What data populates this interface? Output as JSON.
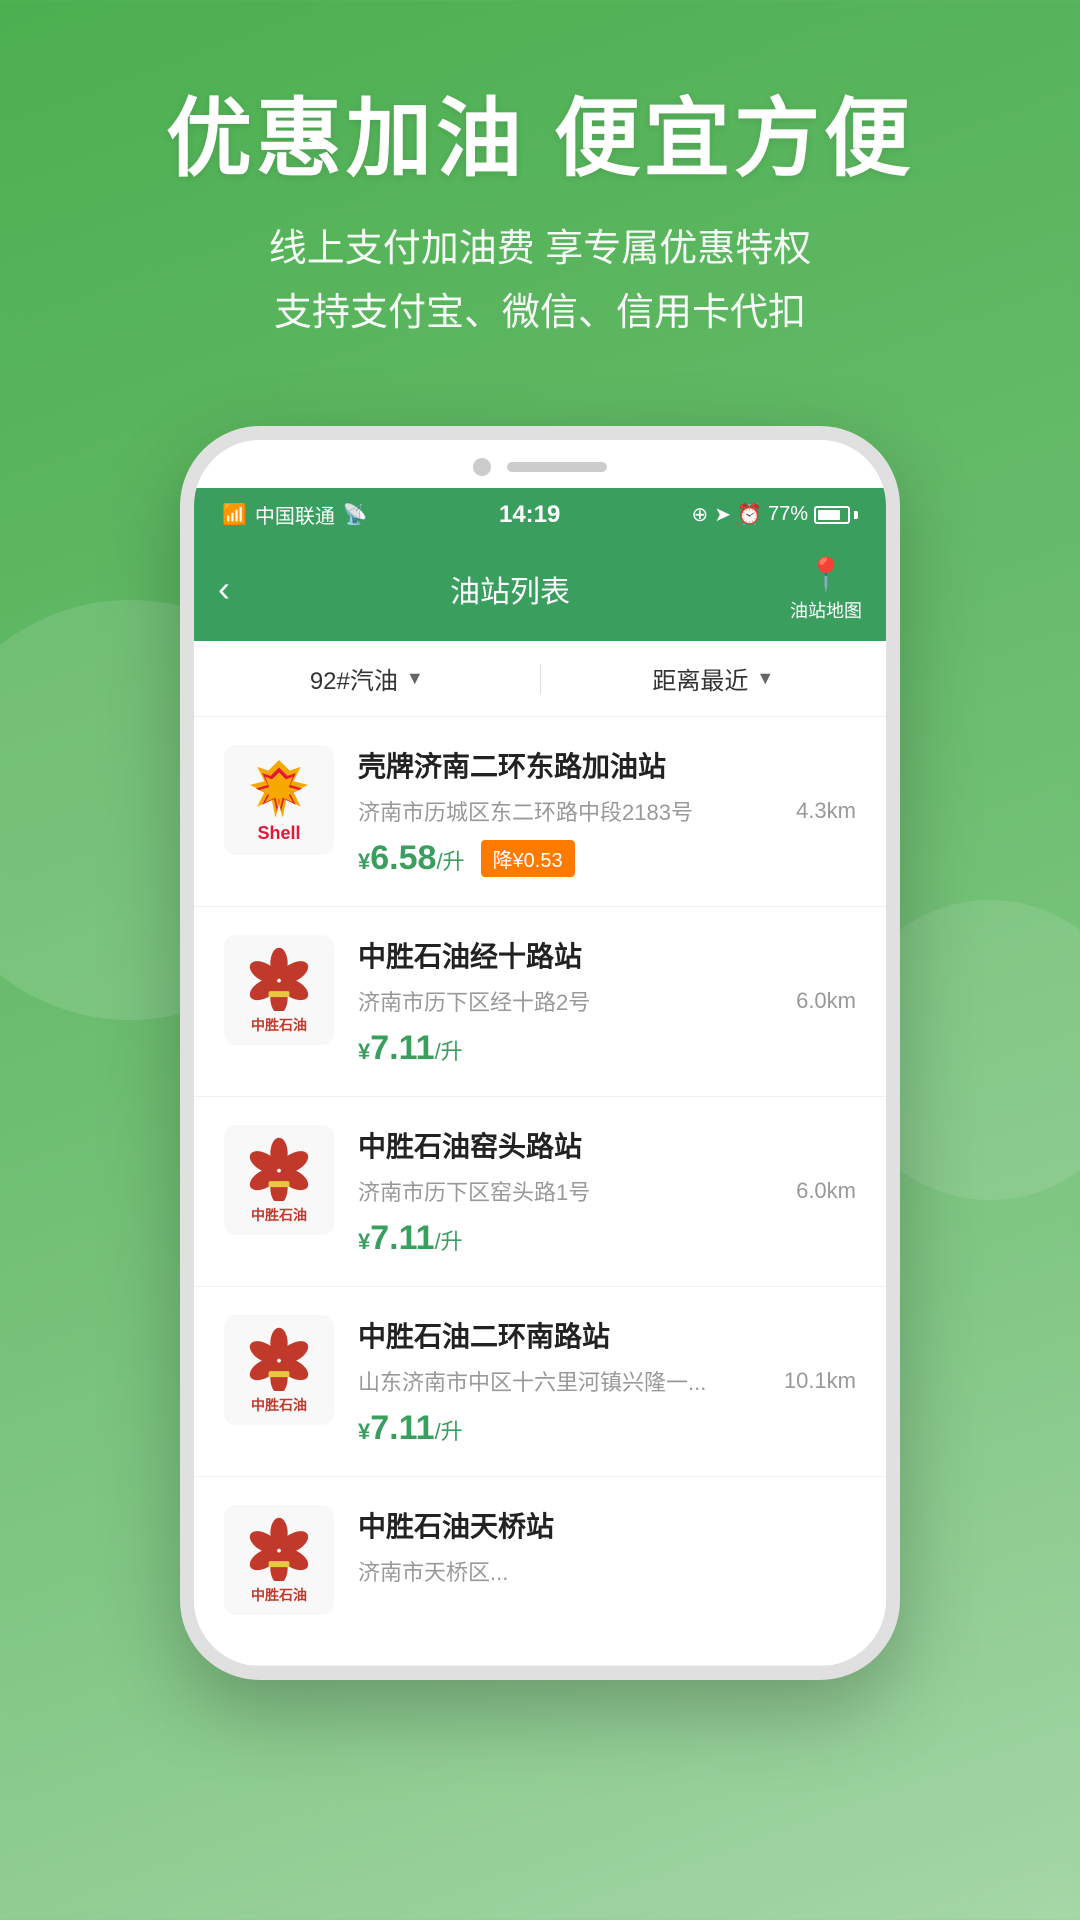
{
  "hero": {
    "title": "优惠加油 便宜方便",
    "subtitle_line1": "线上支付加油费 享专属优惠特权",
    "subtitle_line2": "支持支付宝、微信、信用卡代扣"
  },
  "status_bar": {
    "carrier": "中国联通",
    "time": "14:19",
    "battery_percent": "77%"
  },
  "nav": {
    "back_icon": "‹",
    "title": "油站列表",
    "map_label": "油站地图"
  },
  "filters": {
    "fuel_type": "92#汽油",
    "sort_type": "距离最近"
  },
  "stations": [
    {
      "name": "壳牌济南二环东路加油站",
      "address": "济南市历城区东二环路中段2183号",
      "distance": "4.3km",
      "price": "6.58",
      "unit": "/升",
      "discount": "降¥0.53",
      "brand": "shell"
    },
    {
      "name": "中胜石油经十路站",
      "address": "济南市历下区经十路2号",
      "distance": "6.0km",
      "price": "7.11",
      "unit": "/升",
      "discount": "",
      "brand": "zhongsheng"
    },
    {
      "name": "中胜石油窑头路站",
      "address": "济南市历下区窑头路1号",
      "distance": "6.0km",
      "price": "7.11",
      "unit": "/升",
      "discount": "",
      "brand": "zhongsheng"
    },
    {
      "name": "中胜石油二环南路站",
      "address": "山东济南市中区十六里河镇兴隆一...",
      "distance": "10.1km",
      "price": "7.11",
      "unit": "/升",
      "discount": "",
      "brand": "zhongsheng"
    },
    {
      "name": "中胜石油天桥站",
      "address": "济南市天桥区...",
      "distance": "",
      "price": "",
      "unit": "",
      "discount": "",
      "brand": "zhongsheng"
    }
  ]
}
